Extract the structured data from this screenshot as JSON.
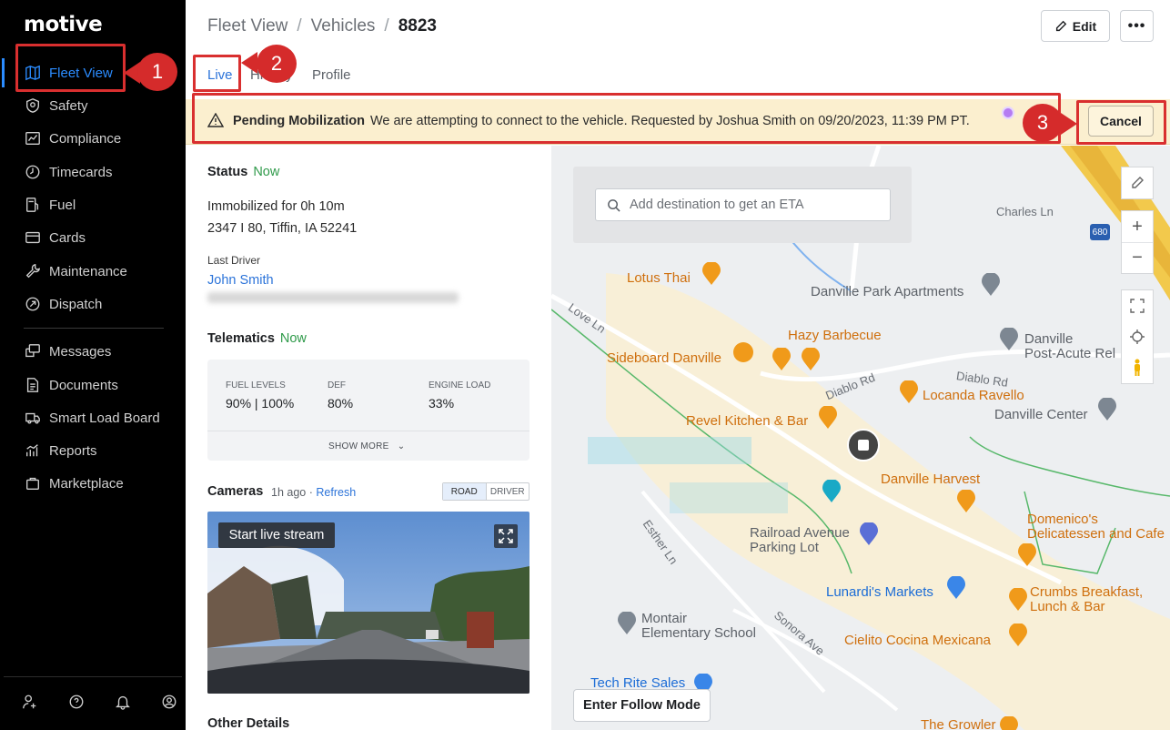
{
  "sidebar": {
    "logo": "motive",
    "items": [
      {
        "label": "Fleet View"
      },
      {
        "label": "Safety"
      },
      {
        "label": "Compliance"
      },
      {
        "label": "Timecards"
      },
      {
        "label": "Fuel"
      },
      {
        "label": "Cards"
      },
      {
        "label": "Maintenance"
      },
      {
        "label": "Dispatch"
      },
      {
        "label": "Messages"
      },
      {
        "label": "Documents"
      },
      {
        "label": "Smart Load Board"
      },
      {
        "label": "Reports"
      },
      {
        "label": "Marketplace"
      }
    ]
  },
  "header": {
    "breadcrumb": [
      "Fleet View",
      "Vehicles",
      "8823"
    ],
    "edit_label": "Edit",
    "more_label": "•••"
  },
  "tabs": [
    "Live",
    "History",
    "Profile"
  ],
  "banner": {
    "title": "Pending Mobilization",
    "message": "We are attempting to connect to the vehicle. Requested by Joshua Smith on 09/20/2023, 11:39 PM PT.",
    "cancel_label": "Cancel"
  },
  "status": {
    "title": "Status",
    "updated": "Now",
    "state": "Immobilized for 0h 10m",
    "location": "2347 I 80, Tiffin, IA 52241",
    "last_driver_label": "Last Driver",
    "last_driver": "John Smith"
  },
  "telematics": {
    "title": "Telematics",
    "updated": "Now",
    "fuel_label": "FUEL LEVELS",
    "fuel_value": "90% | 100%",
    "def_label": "DEF",
    "def_value": "80%",
    "engine_label": "ENGINE LOAD",
    "engine_value": "33%",
    "show_more": "SHOW MORE"
  },
  "cameras": {
    "title": "Cameras",
    "ago": "1h ago",
    "dot": "·",
    "refresh": "Refresh",
    "road": "ROAD",
    "driver": "DRIVER",
    "live_stream": "Start live stream"
  },
  "other_details": "Other Details",
  "map": {
    "search_placeholder": "Add destination to get an ETA",
    "follow_mode": "Enter Follow Mode",
    "places": {
      "lotus_thai": "Lotus Thai",
      "danville_park": "Danville Park Apartments",
      "hazy_bbq": "Hazy Barbecue",
      "sideboard": "Sideboard Danville",
      "danville_postacute": "Danville\nPost-Acute Rel",
      "locanda": "Locanda Ravello",
      "revel": "Revel Kitchen & Bar",
      "danville_center": "Danville Center",
      "danville_harvest": "Danville Harvest",
      "domenicos": "Domenico's\nDelicatessen and Cafe",
      "railroad": "Railroad Avenue\nParking Lot",
      "lunardis": "Lunardi's Markets",
      "crumbs": "Crumbs Breakfast,\nLunch & Bar",
      "montair": "Montair\nElementary School",
      "cielito": "Cielito Cocina Mexicana",
      "tech_rite": "Tech Rite Sales",
      "growler": "The Growler"
    },
    "roads": {
      "charles": "Charles Ln",
      "love": "Love Ln",
      "diablo1": "Diablo Rd",
      "diablo2": "Diablo Rd",
      "esther": "Esther Ln",
      "sonora": "Sonora Ave",
      "interstate": "680"
    }
  },
  "annotations": [
    "1",
    "2",
    "3"
  ],
  "colors": {
    "accent": "#2b73d9",
    "banner_bg": "#fbefcf",
    "annotation_red": "#d52b2b",
    "status_green": "#2f9a4a"
  }
}
